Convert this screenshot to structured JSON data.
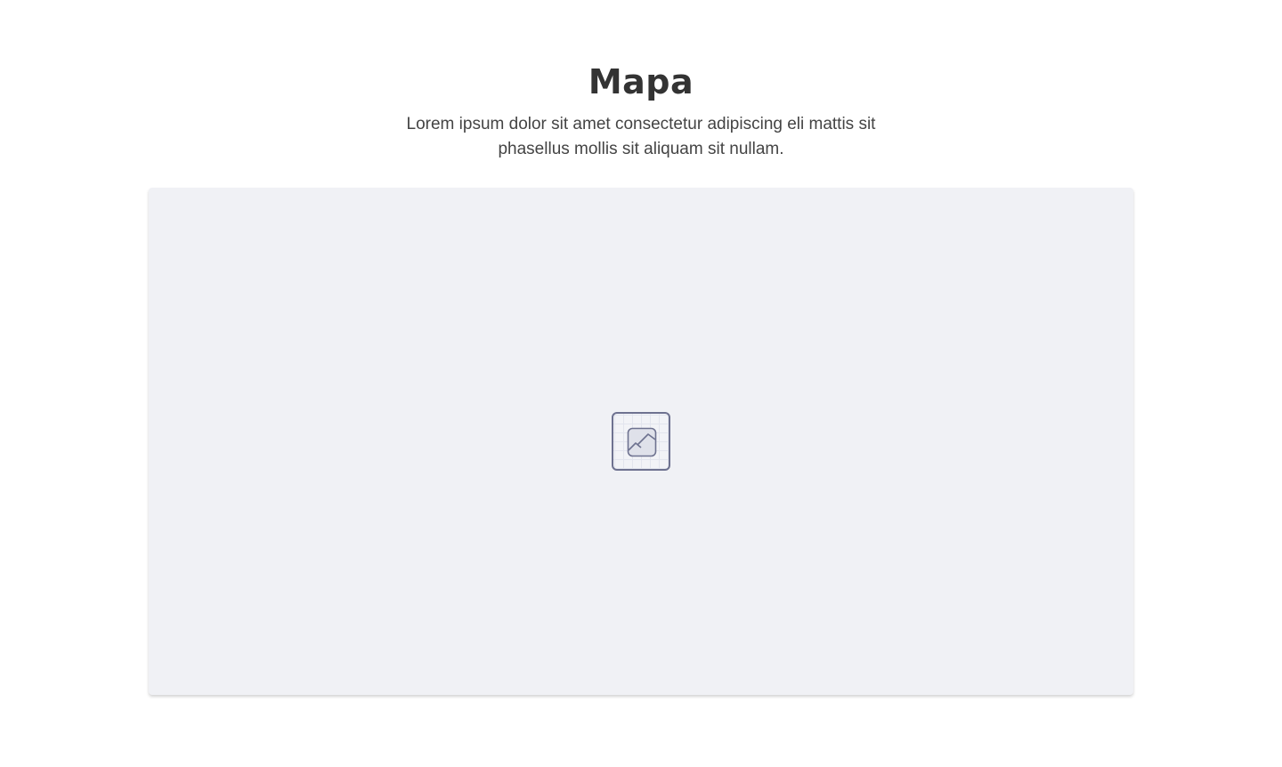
{
  "header": {
    "title": "Mapa",
    "description": "Lorem ipsum dolor sit amet consectetur adipiscing eli mattis sit phasellus mollis sit aliquam sit nullam."
  },
  "map": {
    "placeholder_icon": "image-placeholder-icon",
    "background_color": "#f0f1f5",
    "icon_color": "#6e7290"
  }
}
